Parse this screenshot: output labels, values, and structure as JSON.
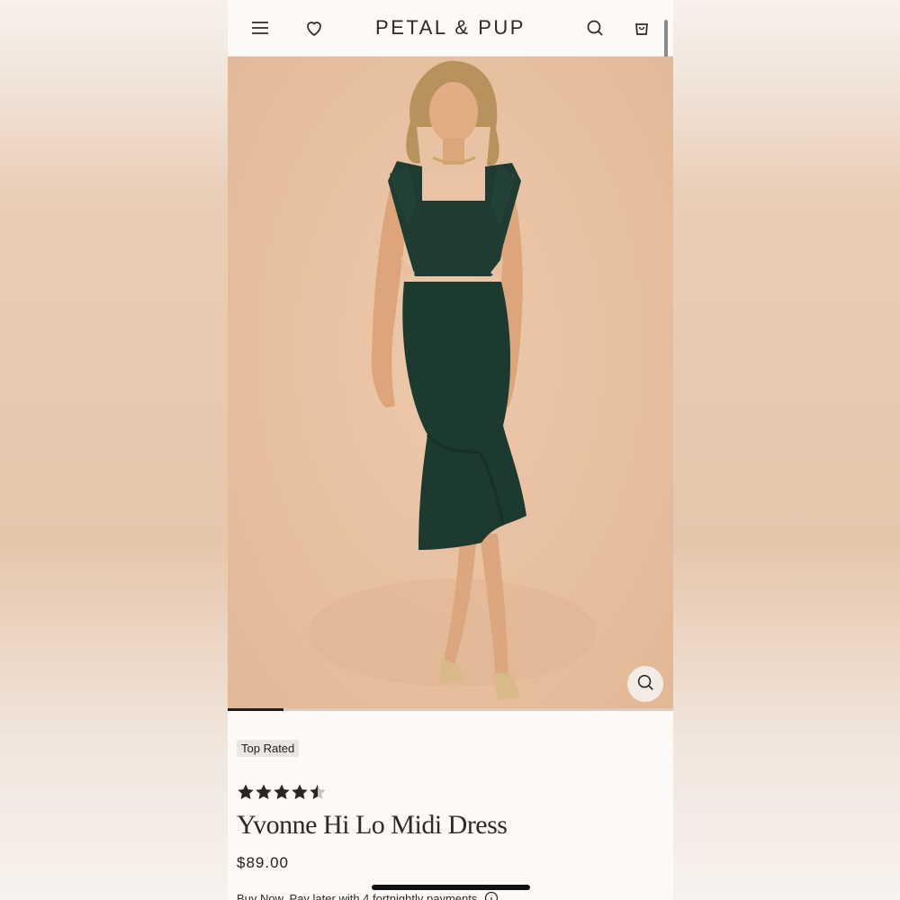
{
  "header": {
    "brand": "PETAL & PUP",
    "icons": [
      "menu-icon",
      "heart-icon",
      "search-icon",
      "cart-icon"
    ]
  },
  "gallery": {
    "image_description_icon": "zoom-icon",
    "progress": 0.125
  },
  "product": {
    "badge": "Top Rated",
    "rating": 4.5,
    "rating_max": 5,
    "title": "Yvonne Hi Lo Midi Dress",
    "price": "$89.00",
    "pay_later": "Buy Now, Pay later with 4 fortnightly payments"
  },
  "colors": {
    "dress": "#1f3b32",
    "background": "#e7c0a0",
    "text": "#2a2a2a"
  }
}
